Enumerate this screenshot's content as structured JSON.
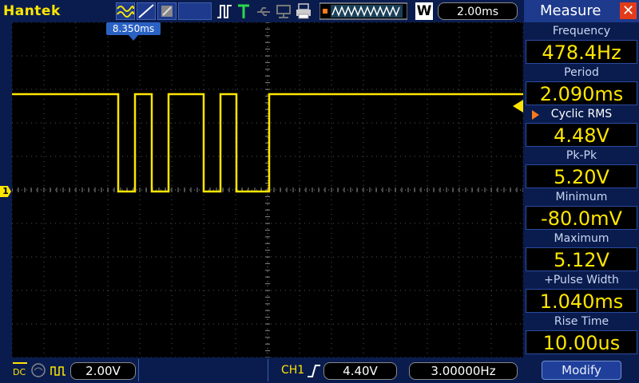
{
  "app": {
    "brand": "Hantek"
  },
  "toolbar": {
    "timebase": "2.00ms",
    "mode_letter": "W",
    "trigger_mode_icon": "trigger-T-icon"
  },
  "screen": {
    "trigger_position": "8.350ms",
    "channel_marker": "1"
  },
  "measure": {
    "title": "Measure",
    "items": [
      {
        "label": "Frequency",
        "value": "478.4Hz"
      },
      {
        "label": "Period",
        "value": "2.090ms"
      },
      {
        "label": "Cyclic RMS",
        "value": "4.48V",
        "selected": true
      },
      {
        "label": "Pk-Pk",
        "value": "5.20V"
      },
      {
        "label": "Minimum",
        "value": "-80.0mV"
      },
      {
        "label": "Maximum",
        "value": "5.12V"
      },
      {
        "label": "+Pulse Width",
        "value": "1.040ms"
      },
      {
        "label": "Rise Time",
        "value": "10.00us"
      }
    ],
    "modify_label": "Modify"
  },
  "bottom": {
    "coupling": "DC",
    "volts_div": "2.00V",
    "trigger_channel": "CH1",
    "trigger_level": "4.40V",
    "trigger_freq": "3.00000Hz"
  },
  "colors": {
    "trace": "#ffe600",
    "accent": "#2a62c4",
    "close": "#e33b1a"
  }
}
